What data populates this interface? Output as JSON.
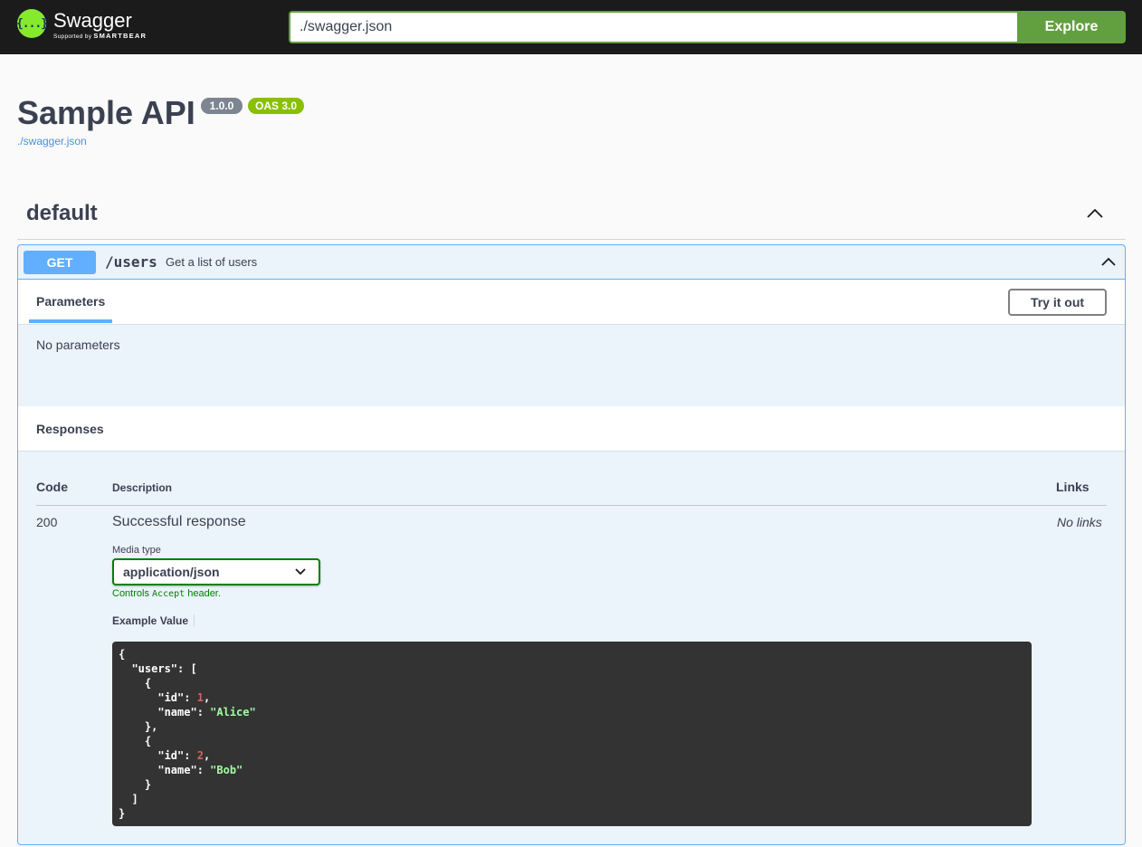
{
  "topbar": {
    "logo_mark": "{...}",
    "logo_name": "Swagger",
    "logo_sub_prefix": "Supported by",
    "logo_sub_brand": "SMARTBEAR",
    "url_value": "./swagger.json",
    "explore_label": "Explore",
    "accent_color": "#62a03f"
  },
  "info": {
    "title": "Sample API",
    "version": "1.0.0",
    "oas": "OAS 3.0",
    "spec_link": "./swagger.json"
  },
  "tag": {
    "name": "default",
    "chevron_icon": "chevron-up-icon"
  },
  "operation": {
    "method": "GET",
    "path": "/users",
    "summary": "Get a list of users",
    "method_color": "#61affe",
    "tab_parameters": "Parameters",
    "try_it_out": "Try it out",
    "no_parameters": "No parameters",
    "responses_title": "Responses",
    "columns": {
      "code": "Code",
      "description": "Description",
      "links": "Links"
    },
    "response": {
      "code": "200",
      "description": "Successful response",
      "links": "No links",
      "media_type_label": "Media type",
      "media_type_value": "application/json",
      "controls_prefix": "Controls",
      "controls_mono": "Accept",
      "controls_suffix": "header.",
      "example_label": "Example Value",
      "example": {
        "users": [
          {
            "id": 1,
            "name": "Alice"
          },
          {
            "id": 2,
            "name": "Bob"
          }
        ]
      }
    }
  }
}
